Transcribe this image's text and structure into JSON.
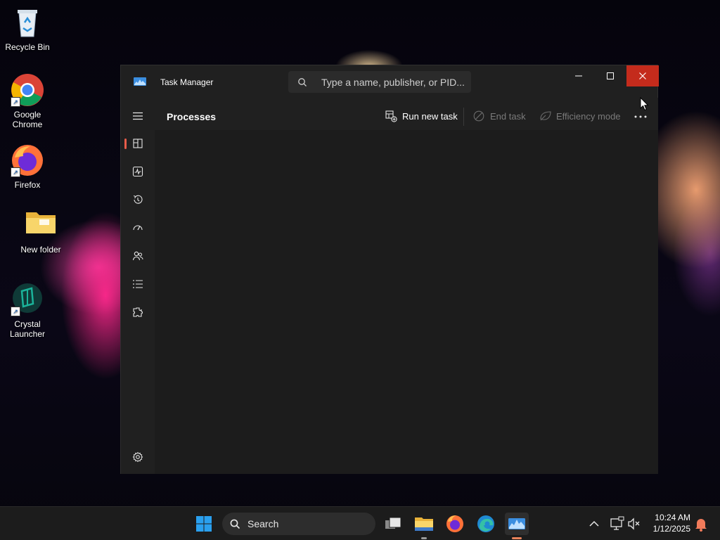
{
  "desktop": {
    "icons": [
      {
        "label": "Recycle Bin",
        "icon": "recycle-bin-icon"
      },
      {
        "label": "Google Chrome",
        "icon": "chrome-icon"
      },
      {
        "label": "Firefox",
        "icon": "firefox-icon"
      },
      {
        "label": "New folder",
        "icon": "folder-icon"
      },
      {
        "label": "Crystal Launcher",
        "icon": "crystal-launcher-icon"
      }
    ]
  },
  "window": {
    "title": "Task Manager",
    "search_placeholder": "Type a name, publisher, or PID...",
    "controls": {
      "minimize": "minimize-icon",
      "maximize": "maximize-icon",
      "close": "close-icon"
    }
  },
  "sidebar": {
    "items": [
      {
        "name": "Processes",
        "icon": "processes-icon",
        "active": true
      },
      {
        "name": "Performance",
        "icon": "performance-icon"
      },
      {
        "name": "App history",
        "icon": "app-history-icon"
      },
      {
        "name": "Startup apps",
        "icon": "startup-apps-icon"
      },
      {
        "name": "Users",
        "icon": "users-icon"
      },
      {
        "name": "Details",
        "icon": "details-icon"
      },
      {
        "name": "Services",
        "icon": "services-icon"
      }
    ],
    "settings": "settings-icon"
  },
  "page": {
    "title": "Processes",
    "commands": {
      "run_new_task": "Run new task",
      "end_task": "End task",
      "efficiency_mode": "Efficiency mode"
    }
  },
  "taskbar": {
    "search_label": "Search",
    "apps": [
      "start-icon",
      "task-view-icon",
      "file-explorer-icon",
      "firefox-icon",
      "edge-icon",
      "task-manager-icon"
    ],
    "time": "10:24 AM",
    "date": "1/12/2025"
  },
  "colors": {
    "accent": "#e85c4a",
    "close_hover": "#c42b1c",
    "window_bg": "#1c1c1c",
    "chrome_bg": "#202020"
  }
}
